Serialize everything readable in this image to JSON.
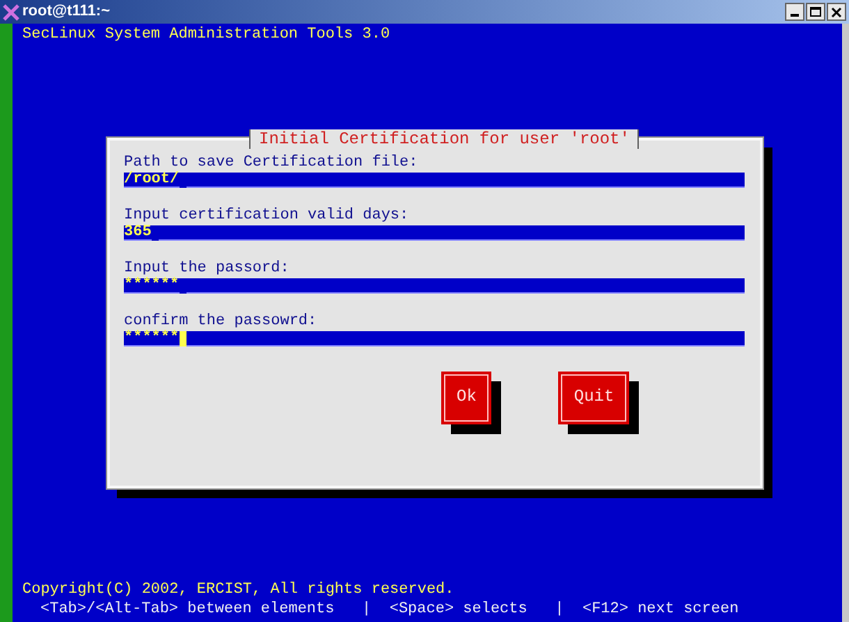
{
  "window": {
    "title": "root@t111:~"
  },
  "header": "SecLinux System Administration Tools 3.0",
  "dialog": {
    "title": "Initial Certification for user 'root'",
    "fields": [
      {
        "label": "Path to save Certification file:",
        "value": "/root/",
        "focused": false
      },
      {
        "label": "Input certification valid days:",
        "value": "365",
        "focused": false
      },
      {
        "label": "Input the passord:",
        "value": "******",
        "focused": false
      },
      {
        "label": "confirm the passowrd:",
        "value": "******",
        "focused": true
      }
    ],
    "buttons": [
      "Ok",
      "Quit"
    ]
  },
  "footer": {
    "copyright": "Copyright(C) 2002, ERCIST, All rights reserved.",
    "help": "<Tab>/<Alt-Tab> between elements   |  <Space> selects   |  <F12> next screen"
  }
}
